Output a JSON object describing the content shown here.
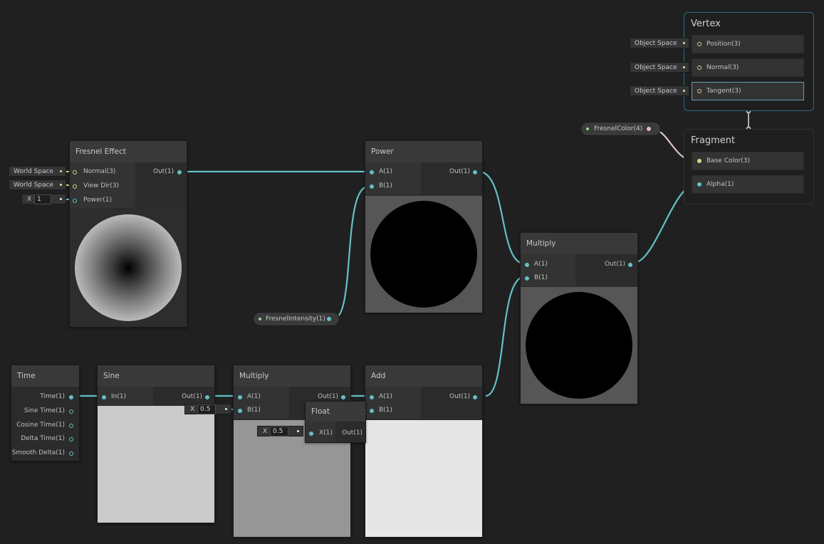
{
  "graph": {
    "fresnel": {
      "title": "Fresnel Effect",
      "inputs": [
        "Normal(3)",
        "View Dir(3)",
        "Power(1)"
      ],
      "output": "Out(1)",
      "chip_normal": "World Space",
      "chip_viewdir": "World Space",
      "power_axis": "X",
      "power_value": "1"
    },
    "power": {
      "title": "Power",
      "inputs": [
        "A(1)",
        "B(1)"
      ],
      "output": "Out(1)"
    },
    "multiply_main": {
      "title": "Multiply",
      "inputs": [
        "A(1)",
        "B(1)"
      ],
      "output": "Out(1)"
    },
    "fresnel_intensity": {
      "label": "FresnelIntensity(1)"
    },
    "fresnel_color": {
      "label": "FresnelColor(4)"
    },
    "time": {
      "title": "Time",
      "outputs": [
        "Time(1)",
        "Sine Time(1)",
        "Cosine Time(1)",
        "Delta Time(1)",
        "Smooth Delta(1)"
      ]
    },
    "sine": {
      "title": "Sine",
      "input": "In(1)",
      "output": "Out(1)"
    },
    "multiply_sine": {
      "title": "Multiply",
      "inputs": [
        "A(1)",
        "B(1)"
      ],
      "output": "Out(1)",
      "b_axis": "X",
      "b_value": "0.5"
    },
    "float": {
      "title": "Float",
      "input": "X(1)",
      "output": "Out(1)",
      "x_axis": "X",
      "x_value": "0.5"
    },
    "add": {
      "title": "Add",
      "inputs": [
        "A(1)",
        "B(1)"
      ],
      "output": "Out(1)"
    }
  },
  "master": {
    "vertex": {
      "title": "Vertex",
      "slots": [
        "Position(3)",
        "Normal(3)",
        "Tangent(3)"
      ],
      "chips": [
        "Object Space",
        "Object Space",
        "Object Space"
      ]
    },
    "fragment": {
      "title": "Fragment",
      "slots": [
        "Base Color(3)",
        "Alpha(1)"
      ]
    }
  },
  "colors": {
    "background": "#202020",
    "wire_float": "#63c1c7",
    "wire_color": "#e4b8c9",
    "selection": "#2c6a80"
  }
}
